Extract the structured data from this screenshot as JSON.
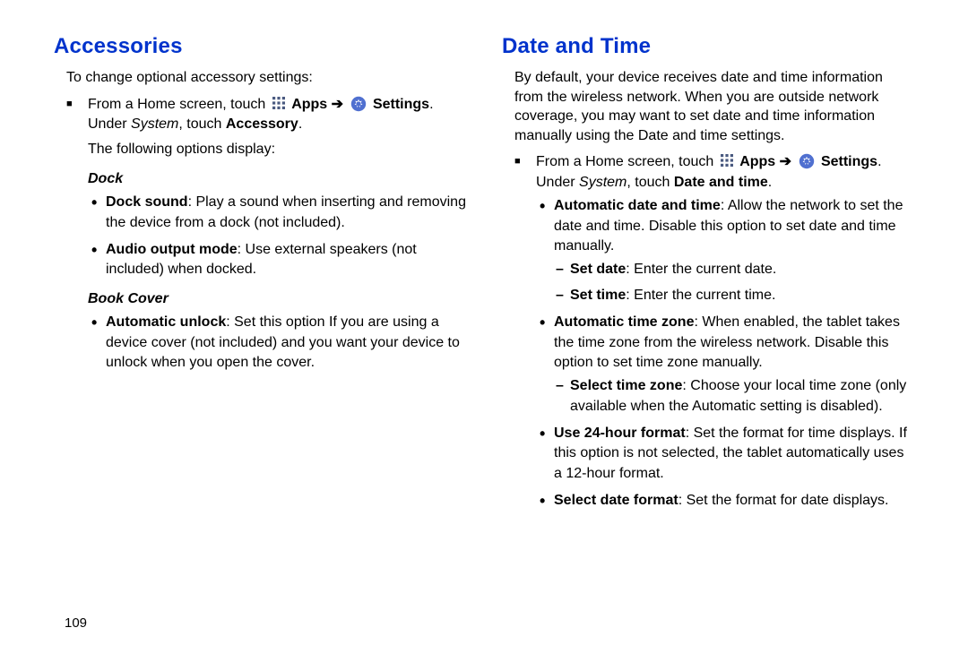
{
  "left": {
    "heading": "Accessories",
    "intro": "To change optional accessory settings:",
    "nav_prefix": "From a Home screen, touch ",
    "nav_apps": "Apps",
    "nav_arrow": " ➔ ",
    "nav_settings": "Settings",
    "nav_period": ".",
    "nav_line2_a": "Under ",
    "nav_line2_b": "System",
    "nav_line2_c": ", touch ",
    "nav_line2_d": "Accessory",
    "nav_line2_e": ".",
    "after": "The following options display:",
    "dock_heading": "Dock",
    "dock_items": [
      {
        "bold": "Dock sound",
        "rest": ": Play a sound when inserting and removing the device from a dock (not included)."
      },
      {
        "bold": "Audio output mode",
        "rest": ": Use external speakers (not included) when docked."
      }
    ],
    "book_heading": "Book Cover",
    "book_items": [
      {
        "bold": "Automatic unlock",
        "rest": ": Set this option If you are using a device cover (not included) and you want your device to unlock when you open the cover."
      }
    ]
  },
  "right": {
    "heading": "Date and Time",
    "intro": "By default, your device receives date and time information from the wireless network. When you are outside network coverage, you may want to set date and time information manually using the Date and time settings.",
    "nav_prefix": "From a Home screen, touch ",
    "nav_apps": "Apps",
    "nav_arrow": " ➔ ",
    "nav_settings": "Settings",
    "nav_period": ".",
    "nav_line2_a": "Under ",
    "nav_line2_b": "System",
    "nav_line2_c": ", touch ",
    "nav_line2_d": "Date and time",
    "nav_line2_e": ".",
    "items": [
      {
        "bold": "Automatic date and time",
        "rest": ": Allow the network to set the date and time. Disable this option to set date and time manually.",
        "sub": [
          {
            "bold": "Set date",
            "rest": ": Enter the current date."
          },
          {
            "bold": "Set time",
            "rest": ": Enter the current time."
          }
        ]
      },
      {
        "bold": "Automatic time zone",
        "rest": ": When enabled, the tablet takes the time zone from the wireless network. Disable this option to set time zone manually.",
        "sub": [
          {
            "bold": "Select time zone",
            "rest": ": Choose your local time zone (only available when the Automatic setting is disabled)."
          }
        ]
      },
      {
        "bold": "Use 24-hour format",
        "rest": ": Set the format for time displays. If this option is not selected, the tablet automatically uses a 12-hour format."
      },
      {
        "bold": "Select date format",
        "rest": ": Set the format for date displays."
      }
    ]
  },
  "page_number": "109"
}
